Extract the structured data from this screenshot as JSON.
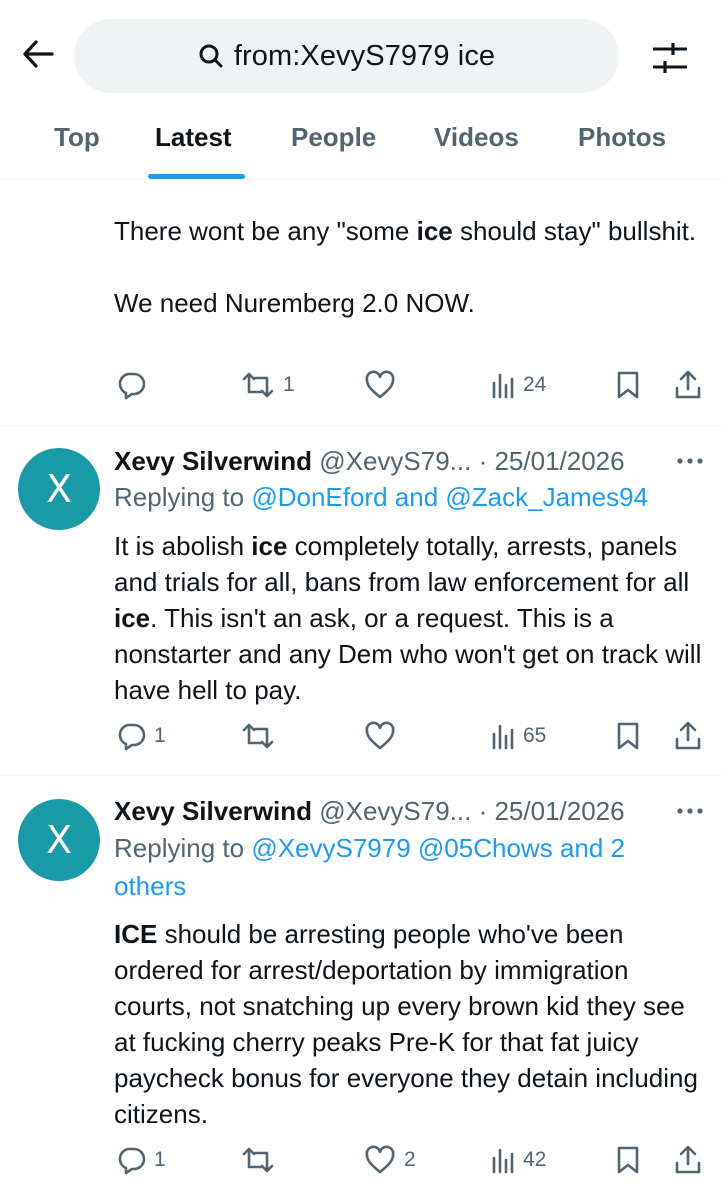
{
  "header": {
    "search_query": "from:XevyS7979 ice"
  },
  "tabs": [
    {
      "label": "Top"
    },
    {
      "label": "Latest"
    },
    {
      "label": "People"
    },
    {
      "label": "Videos"
    },
    {
      "label": "Photos"
    }
  ],
  "tweets": [
    {
      "body_parts": [
        "There wont be any \"some ",
        "ice",
        " should stay\" bullshit.",
        "We need Nuremberg 2.0 NOW."
      ],
      "replies": "",
      "retweets": "1",
      "likes": "",
      "views": "24"
    },
    {
      "name": "Xevy Silverwind",
      "handle": "@XevyS79...",
      "date": "· 25/01/2026",
      "replying_prefix": "Replying to",
      "replying_to": "@DonEford and @Zack_James94",
      "body_parts": [
        "It is abolish ",
        "ice",
        " completely totally, arrests, panels and trials for all, bans from law enforcement for all ",
        "ice",
        ". This isn't an ask, or a request. This is a nonstarter and any Dem who won't get on track will have hell to pay."
      ],
      "replies": "1",
      "retweets": "",
      "likes": "",
      "views": "65"
    },
    {
      "name": "Xevy Silverwind",
      "handle": "@XevyS79...",
      "date": "· 25/01/2026",
      "replying_prefix": "Replying to",
      "replying_to": "@XevyS7979 @05Chows and 2 others",
      "body_parts": [
        "ICE",
        " should be arresting people who've been ordered for arrest/deportation by immigration courts, not snatching up every brown kid they see at fucking cherry peaks Pre-K  for that fat juicy paycheck bonus for everyone they detain including citizens."
      ],
      "replies": "1",
      "retweets": "",
      "likes": "2",
      "views": "42"
    }
  ],
  "avatar_letter": "X",
  "colors": {
    "accent": "#1d9bf0",
    "avatar": "#1a9aa6",
    "text": "#0f1419",
    "muted": "#536471"
  }
}
